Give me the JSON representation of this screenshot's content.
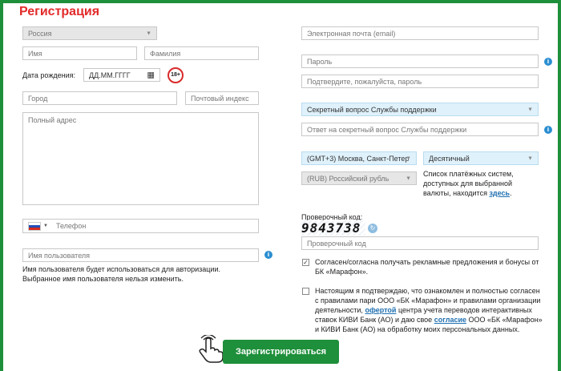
{
  "form": {
    "title": "Регистрация",
    "country": "Россия",
    "first_name_ph": "Имя",
    "last_name_ph": "Фамилия",
    "birthdate_label": "Дата рождения:",
    "birthdate_ph": "ДД.ММ.ГГГГ",
    "age_badge": "18+",
    "city_ph": "Город",
    "postal_ph": "Почтовый индекс",
    "address_ph": "Полный адрес",
    "phone_ph": "Телефон",
    "username_ph": "Имя пользователя",
    "username_help_1": "Имя пользователя будет использоваться для авторизации.",
    "username_help_2": "Выбранное имя пользователя нельзя изменить.",
    "email_ph": "Электронная почта (email)",
    "password_ph": "Пароль",
    "password_confirm_ph": "Подтвердите, пожалуйста, пароль",
    "secret_question": "Секретный вопрос Службы поддержки",
    "secret_answer_ph": "Ответ на секретный вопрос Службы поддержки",
    "timezone": "(GMT+3) Москва, Санкт-Петер",
    "odds_format": "Десятичный",
    "currency": "(RUB) Российский рубль",
    "payment_note_1": "Список платёжных систем,",
    "payment_note_2": "доступных для выбранной",
    "payment_note_3": "валюты, находится",
    "payment_link": "здесь",
    "captcha_label": "Проверочный код:",
    "captcha_code": "9843738",
    "captcha_ph": "Проверочный код",
    "promo_1": "Согласен/согласна получать рекламные предложения и бонусы от",
    "promo_2": "БК «Марафон».",
    "terms_1": "Настоящим я подтверждаю, что ознакомлен и полностью согласен",
    "terms_2": "с правилами пари ООО «БК «Марафон» и правилами организации",
    "terms_3a": "деятельности,",
    "terms_link1": "офертой",
    "terms_3b": "центра учета переводов интерактивных",
    "terms_4a": "ставок КИВИ Банк (АО) и даю свое",
    "terms_link2": "согласие",
    "terms_4b": "ООО «БК «Марафон»",
    "terms_5": "и КИВИ Банк (АО) на обработку моих персональных данных.",
    "submit": "Зарегистрироваться",
    "info_glyph": "i",
    "check_glyph": "✓",
    "caret_glyph": "▼",
    "calendar_glyph": "▦",
    "refresh_glyph": "↻"
  },
  "state": {
    "promo_checked": true,
    "terms_checked": false
  },
  "colors": {
    "accent": "#1e8f3a",
    "title": "#e32a2a",
    "info": "#2b8ed1",
    "select_bg": "#dff1fb"
  }
}
